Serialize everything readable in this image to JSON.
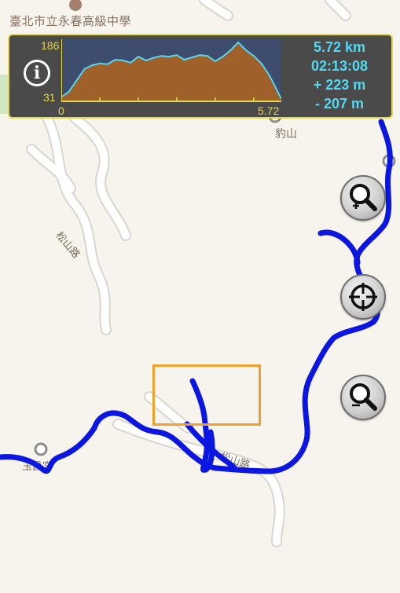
{
  "map": {
    "school_label": "臺北市立永春高級中學",
    "peak_label": "豹山",
    "road_label_upper": "松山路",
    "road_label_lower": "松山路",
    "place_label": "玉昌宮"
  },
  "elevation_panel": {
    "y_max": "186",
    "y_min": "31",
    "x_min": "0",
    "x_max": "5.72",
    "distance": "5.72 km",
    "duration": "02:13:08",
    "ascent": "+ 223 m",
    "descent": "- 207 m",
    "info_glyph": "i"
  },
  "chart_data": {
    "type": "area",
    "xlim": [
      0,
      5.72
    ],
    "ylim": [
      31,
      186
    ],
    "x": [
      0,
      0.2,
      0.4,
      0.6,
      0.8,
      1.0,
      1.2,
      1.4,
      1.6,
      1.8,
      2.0,
      2.2,
      2.4,
      2.6,
      2.8,
      3.0,
      3.2,
      3.4,
      3.6,
      3.8,
      4.0,
      4.2,
      4.4,
      4.6,
      4.8,
      5.0,
      5.2,
      5.4,
      5.6,
      5.72
    ],
    "y": [
      40,
      55,
      85,
      115,
      125,
      130,
      128,
      140,
      138,
      132,
      148,
      138,
      145,
      150,
      148,
      152,
      140,
      146,
      152,
      150,
      136,
      148,
      165,
      186,
      165,
      150,
      130,
      100,
      60,
      35
    ]
  },
  "buttons": {
    "zoom_in": "zoom-in",
    "locate": "locate",
    "zoom_out": "zoom-out"
  },
  "colors": {
    "track": "#0b16e0",
    "panel_bg": "#4a4a4a",
    "panel_border": "#e6d84a",
    "elevation_fill": "#a0602a",
    "elevation_line": "#55d7f0",
    "stats_text": "#55d7f0",
    "highlight_box": "#f1a02a"
  }
}
